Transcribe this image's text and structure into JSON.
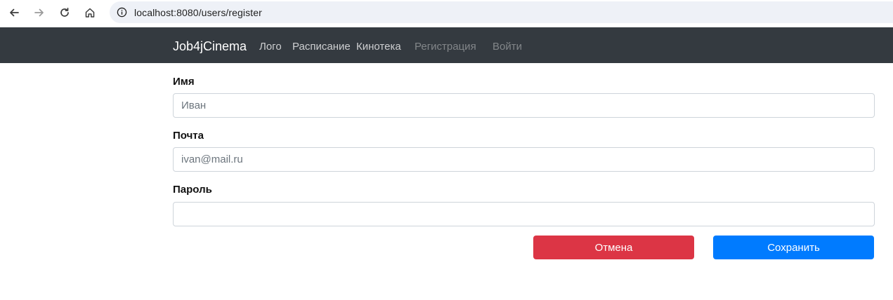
{
  "browser": {
    "url": "localhost:8080/users/register",
    "icons": [
      "back-arrow-icon",
      "forward-arrow-icon",
      "reload-icon",
      "home-icon",
      "site-info-icon"
    ]
  },
  "navbar": {
    "brand": "Job4jCinema",
    "links": [
      "Лого",
      "Расписание",
      "Кинотека",
      "Регистрация",
      "Войти"
    ],
    "background": "#343a40"
  },
  "form": {
    "name": {
      "label": "Имя",
      "placeholder": "Иван"
    },
    "email": {
      "label": "Почта",
      "placeholder": "ivan@mail.ru"
    },
    "password": {
      "label": "Пароль",
      "placeholder": ""
    },
    "cancel_label": "Отмена",
    "save_label": "Сохранить"
  },
  "colors": {
    "danger": "#dc3545",
    "primary": "#007bff"
  }
}
